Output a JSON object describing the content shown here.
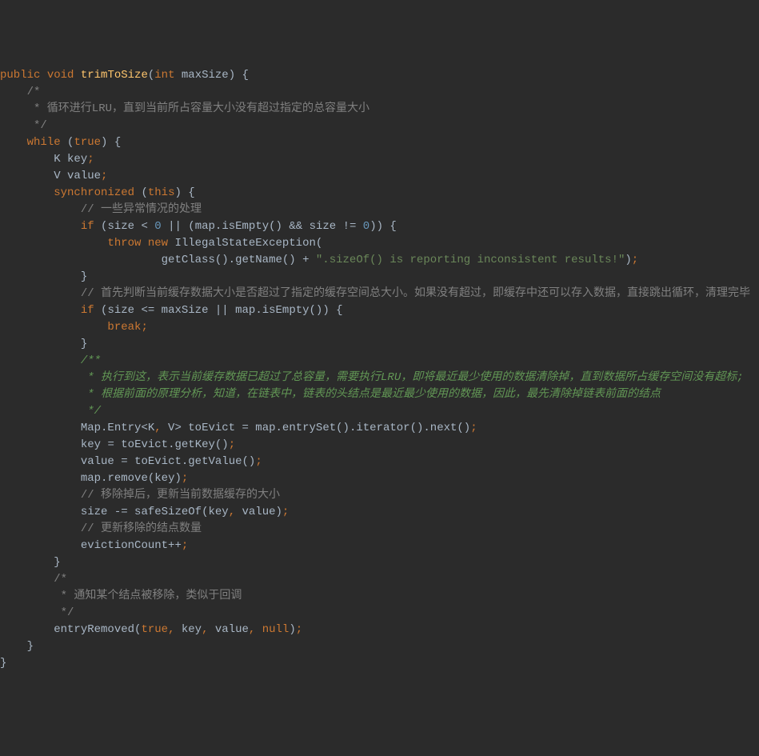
{
  "code": {
    "l1": {
      "kw1": "public",
      "kw2": "void",
      "method": "trimToSize",
      "paren1": "(",
      "kw3": "int",
      "param": "maxSize",
      "paren2": ")",
      "brace": " {"
    },
    "l2": {
      "c": "    /*"
    },
    "l3": {
      "c": "     * 循环进行LRU，直到当前所占容量大小没有超过指定的总容量大小"
    },
    "l4": {
      "c": "     */"
    },
    "l5": {
      "kw": "    while",
      "paren1": " (",
      "kw2": "true",
      "paren2": ") {"
    },
    "l6": {
      "indent": "        ",
      "t1": "K ",
      "v": "key",
      "semi": ";"
    },
    "l7": {
      "indent": "        ",
      "t1": "V ",
      "v": "value",
      "semi": ";"
    },
    "l8": {
      "indent": "        ",
      "kw": "synchronized",
      "paren1": " (",
      "kw2": "this",
      "paren2": ") {"
    },
    "l9": {
      "c": "            // 一些异常情况的处理"
    },
    "l10": {
      "indent": "            ",
      "kw": "if",
      "paren1": " (",
      "v1": "size",
      "op1": " < ",
      "n1": "0",
      "op2": " || (",
      "v2": "map",
      "dot1": ".",
      "m1": "isEmpty",
      "p1": "()",
      "op3": " && ",
      "v3": "size",
      "op4": " != ",
      "n2": "0",
      "paren2": ")) {"
    },
    "l11": {
      "indent": "                ",
      "kw1": "throw",
      "kw2": " new",
      "t": " IllegalStateException",
      "paren": "("
    },
    "l12": {
      "indent": "                        ",
      "m1": "getClass",
      "p1": "().",
      "m2": "getName",
      "p2": "() + ",
      "s": "\".sizeOf() is reporting inconsistent results!\"",
      "paren": ")",
      "semi": ";"
    },
    "l13": {
      "indent": "            ",
      "brace": "}"
    },
    "l14": {
      "c": "            // 首先判断当前缓存数据大小是否超过了指定的缓存空间总大小。如果没有超过，即缓存中还可以存入数据，直接跳出循环，清理完毕"
    },
    "l15": {
      "indent": "            ",
      "kw": "if",
      "paren1": " (",
      "v1": "size",
      "op1": " <= ",
      "v2": "maxSize",
      "op2": " || ",
      "v3": "map",
      "dot": ".",
      "m": "isEmpty",
      "p": "()",
      "paren2": ") {"
    },
    "l16": {
      "indent": "                ",
      "kw": "break",
      "semi": ";"
    },
    "l17": {
      "indent": "            ",
      "brace": "}"
    },
    "l18": {
      "c": "            /**"
    },
    "l19": {
      "c": "             * 执行到这，表示当前缓存数据已超过了总容量，需要执行LRU，即将最近最少使用的数据清除掉，直到数据所占缓存空间没有超标;"
    },
    "l20": {
      "c": "             * 根据前面的原理分析，知道，在链表中，链表的头结点是最近最少使用的数据，因此，最先清除掉链表前面的结点"
    },
    "l21": {
      "c": "             */"
    },
    "l22": {
      "indent": "            ",
      "t1": "Map.Entry<K",
      "comma1": ",",
      "t2": " V> ",
      "v1": "toEvict",
      "op": " = ",
      "v2": "map",
      "dot1": ".",
      "m1": "entrySet",
      "p1": "().",
      "m2": "iterator",
      "p2": "().",
      "m3": "next",
      "p3": "()",
      "semi": ";"
    },
    "l23": {
      "indent": "            ",
      "v1": "key",
      "op": " = ",
      "v2": "toEvict",
      "dot": ".",
      "m": "getKey",
      "p": "()",
      "semi": ";"
    },
    "l24": {
      "indent": "            ",
      "v1": "value",
      "op": " = ",
      "v2": "toEvict",
      "dot": ".",
      "m": "getValue",
      "p": "()",
      "semi": ";"
    },
    "l25": {
      "indent": "            ",
      "v1": "map",
      "dot": ".",
      "m": "remove",
      "p1": "(",
      "v2": "key",
      "p2": ")",
      "semi": ";"
    },
    "l26": {
      "c": "            // 移除掉后，更新当前数据缓存的大小"
    },
    "l27": {
      "indent": "            ",
      "v1": "size",
      "op": " -= ",
      "m": "safeSizeOf",
      "p1": "(",
      "v2": "key",
      "comma": ",",
      "v3": " value",
      "p2": ")",
      "semi": ";"
    },
    "l28": {
      "c": "            // 更新移除的结点数量"
    },
    "l29": {
      "indent": "            ",
      "v": "evictionCount",
      "op": "++",
      "semi": ";"
    },
    "l30": {
      "indent": "        ",
      "brace": "}"
    },
    "l31": {
      "c": "        /*"
    },
    "l32": {
      "c": "         * 通知某个结点被移除，类似于回调"
    },
    "l33": {
      "c": "         */"
    },
    "l34": {
      "indent": "        ",
      "m": "entryRemoved",
      "p1": "(",
      "kw1": "true",
      "comma1": ",",
      "v1": " key",
      "comma2": ",",
      "v2": " value",
      "comma3": ",",
      "kw2": " null",
      "p2": ")",
      "semi": ";"
    },
    "l35": {
      "indent": "    ",
      "brace": "}"
    },
    "l36": {
      "brace": "}"
    }
  }
}
